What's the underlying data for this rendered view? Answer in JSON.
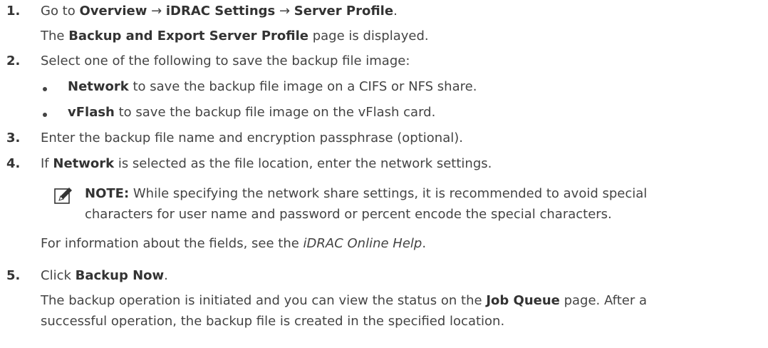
{
  "steps": [
    {
      "number": "1.",
      "line1": {
        "pre": "Go to ",
        "b1": "Overview",
        "arrow1": " → ",
        "b2": "iDRAC Settings",
        "arrow2": " → ",
        "b3": "Server Profile",
        "post": "."
      },
      "line2": {
        "pre": "The ",
        "b1": "Backup and Export Server Profile",
        "post": " page is displayed."
      }
    },
    {
      "number": "2.",
      "text": "Select one of the following to save the backup file image:",
      "bullets": [
        {
          "bold": "Network",
          "text": " to save the backup file image on a CIFS or NFS share."
        },
        {
          "bold": "vFlash",
          "text": " to save the backup file image on the vFlash card."
        }
      ]
    },
    {
      "number": "3.",
      "text": "Enter the backup file name and encryption passphrase (optional)."
    },
    {
      "number": "4.",
      "line1": {
        "pre": "If ",
        "b1": "Network",
        "post": " is selected as the file location, enter the network settings."
      },
      "note": {
        "label": "NOTE:",
        "line1": " While specifying the network share settings, it is recommended to avoid special",
        "line2": "characters for user name and password or percent encode the special characters."
      },
      "info": {
        "pre": "For information about the fields, see the ",
        "ital": "iDRAC Online Help",
        "post": "."
      }
    },
    {
      "number": "5.",
      "line1": {
        "pre": "Click ",
        "b1": "Backup Now",
        "post": "."
      },
      "line2": {
        "pre": "The backup operation is initiated and you can view the status on the ",
        "b1": "Job Queue",
        "post": " page. After a"
      },
      "line3": "successful operation, the backup file is created in the specified location."
    }
  ],
  "icons": {
    "note": "pencil-note-icon"
  }
}
